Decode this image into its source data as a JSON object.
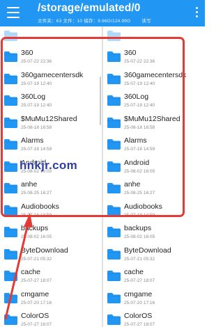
{
  "header": {
    "title": "/storage/emulated/0",
    "file_count": "文件夹：63",
    "files": "文件：10",
    "storage": "储存：9.86G/124.99G",
    "permission": "读写",
    "menu_icon": "hamburger-menu-icon",
    "overflow_icon": "vertical-dots-icon"
  },
  "up_label": "..",
  "left_pane": [
    {
      "name": "360",
      "date": "25-07-22 22:36"
    },
    {
      "name": "360gamecentersdk",
      "date": "25-07-19 12:40"
    },
    {
      "name": "360Log",
      "date": "25-07-19 12:40"
    },
    {
      "name": "$MuMu12Shared",
      "date": "25-08-18 16:58"
    },
    {
      "name": "Alarms",
      "date": "25-07-18 14:59"
    },
    {
      "name": "Android",
      "date": "25-08-02 16:05"
    },
    {
      "name": "anhe",
      "date": "25-08-25 16:27"
    },
    {
      "name": "Audiobooks",
      "date": "25-07-18 14:59"
    },
    {
      "name": "backups",
      "date": "25-08-02 16:05"
    },
    {
      "name": "ByteDownload",
      "date": "25-07-21 05:32"
    },
    {
      "name": "cache",
      "date": "25-07-27 18:07"
    },
    {
      "name": "cmgame",
      "date": "25-07-20 17:16"
    },
    {
      "name": "ColorOS",
      "date": "25-07-27 18:07"
    }
  ],
  "right_pane": [
    {
      "name": "360",
      "date": "25-07-22 22:36"
    },
    {
      "name": "360gamecentersdk",
      "date": "25-07-19 12:40"
    },
    {
      "name": "360Log",
      "date": "25-07-19 12:40"
    },
    {
      "name": "$MuMu12Shared",
      "date": "25-08-18 16:58"
    },
    {
      "name": "Alarms",
      "date": "25-07-18 14:59"
    },
    {
      "name": "Android",
      "date": "25-08-02 16:05"
    },
    {
      "name": "anhe",
      "date": "25-08-25 16:27"
    },
    {
      "name": "Audiobooks",
      "date": "25-07-18 14:59"
    },
    {
      "name": "backups",
      "date": "25-08-02 16:05"
    },
    {
      "name": "ByteDownload",
      "date": "25-07-21 05:32"
    },
    {
      "name": "cache",
      "date": "25-07-27 18:07"
    },
    {
      "name": "cmgame",
      "date": "25-07-20 17:16"
    },
    {
      "name": "ColorOS",
      "date": "25-07-27 18:07"
    }
  ],
  "watermark": "hnkjr.com",
  "colors": {
    "header": "#2196f3",
    "folder": "#2196f3",
    "annotation": "#e53935",
    "watermark": "#2f3f9f"
  }
}
